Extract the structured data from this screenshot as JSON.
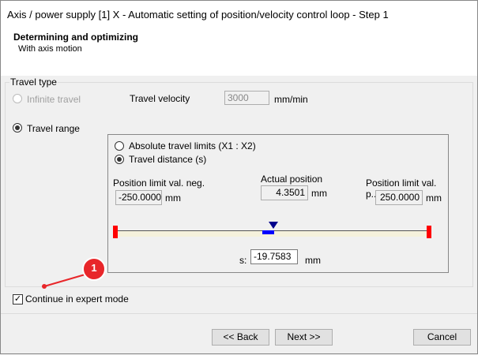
{
  "window": {
    "title": "Axis / power supply [1] X - Automatic setting of position/velocity control loop - Step 1"
  },
  "header": {
    "title": "Determining and optimizing",
    "subtitle": "With axis motion"
  },
  "travel_type": {
    "label": "Travel type",
    "infinite_travel": "Infinite travel",
    "travel_velocity_label": "Travel velocity",
    "travel_velocity": "3000",
    "velocity_unit": "mm/min",
    "travel_range": "Travel range"
  },
  "range": {
    "absolute": "Absolute travel limits (X1 : X2)",
    "distance": "Travel distance (s)",
    "neg_label": "Position limit val. neg.",
    "neg_value": "-250.0000",
    "actual_label": "Actual position",
    "actual_value": "4.3501",
    "pos_label": "Position limit val. p...",
    "pos_value": "250.0000",
    "unit": "mm",
    "s_label": "s:",
    "s_value": "-19.7583"
  },
  "expert_mode": {
    "label": "Continue in expert mode",
    "checked": true
  },
  "buttons": {
    "back": "<< Back",
    "next": "Next >>",
    "cancel": "Cancel"
  },
  "annotation": {
    "number": "1",
    "color": "#e8262a"
  }
}
